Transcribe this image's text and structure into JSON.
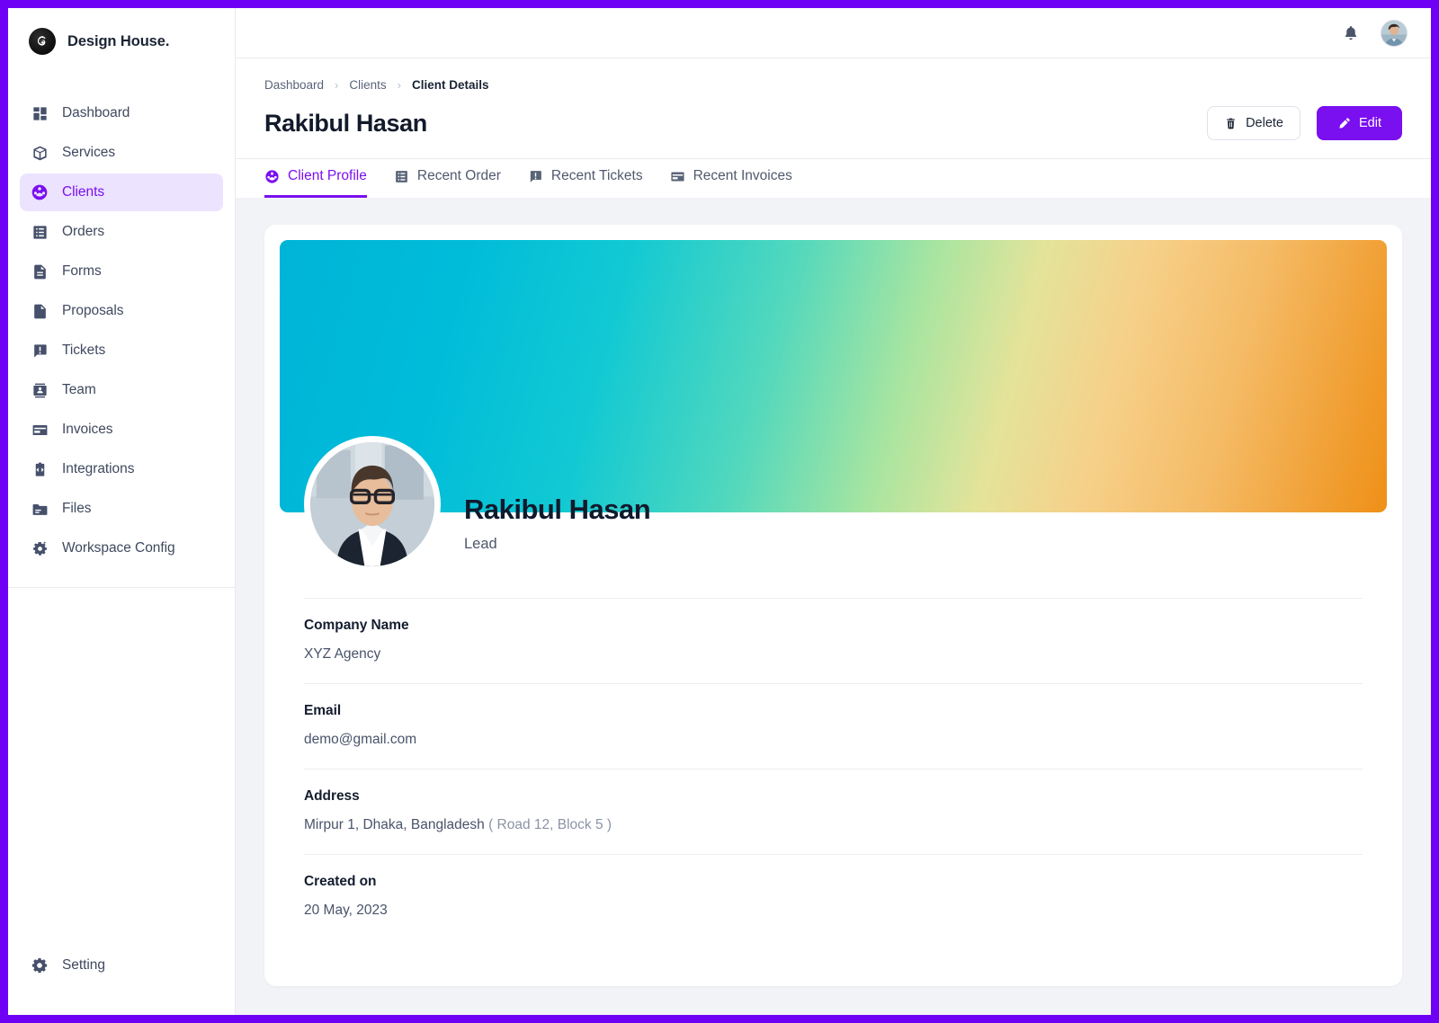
{
  "brand": {
    "name": "Design House.",
    "logo_icon": "swirl-logo-icon"
  },
  "sidebar": {
    "items": [
      {
        "label": "Dashboard",
        "icon": "dashboard-icon",
        "active": false
      },
      {
        "label": "Services",
        "icon": "box-icon",
        "active": false
      },
      {
        "label": "Clients",
        "icon": "clients-icon",
        "active": true
      },
      {
        "label": "Orders",
        "icon": "list-icon",
        "active": false
      },
      {
        "label": "Forms",
        "icon": "document-icon",
        "active": false
      },
      {
        "label": "Proposals",
        "icon": "proposal-icon",
        "active": false
      },
      {
        "label": "Tickets",
        "icon": "ticket-alert-icon",
        "active": false
      },
      {
        "label": "Team",
        "icon": "team-card-icon",
        "active": false
      },
      {
        "label": "Invoices",
        "icon": "invoice-card-icon",
        "active": false
      },
      {
        "label": "Integrations",
        "icon": "integrations-code-icon",
        "active": false
      },
      {
        "label": "Files",
        "icon": "folder-icon",
        "active": false
      },
      {
        "label": "Workspace Config",
        "icon": "gear-sparkle-icon",
        "active": false
      }
    ],
    "footer": {
      "label": "Setting",
      "icon": "gear-icon"
    }
  },
  "topbar": {
    "notification_icon": "bell-icon",
    "avatar_icon": "user-avatar"
  },
  "breadcrumb": {
    "items": [
      "Dashboard",
      "Clients",
      "Client Details"
    ],
    "separator": "›"
  },
  "header": {
    "title": "Rakibul Hasan",
    "delete_label": "Delete",
    "delete_icon": "trash-icon",
    "edit_label": "Edit",
    "edit_icon": "pencil-icon"
  },
  "tabs": [
    {
      "label": "Client Profile",
      "icon": "clients-icon",
      "active": true
    },
    {
      "label": "Recent Order",
      "icon": "list-icon",
      "active": false
    },
    {
      "label": "Recent Tickets",
      "icon": "ticket-alert-icon",
      "active": false
    },
    {
      "label": "Recent Invoices",
      "icon": "invoice-card-icon",
      "active": false
    }
  ],
  "profile": {
    "name": "Rakibul Hasan",
    "role": "Lead",
    "avatar_icon": "user-photo"
  },
  "fields": [
    {
      "label": "Company Name",
      "value": "XYZ Agency",
      "muted": ""
    },
    {
      "label": "Email",
      "value": "demo@gmail.com",
      "muted": ""
    },
    {
      "label": "Address",
      "value": "Mirpur 1, Dhaka, Bangladesh ",
      "muted": "( Road 12, Block 5 )"
    },
    {
      "label": "Created on",
      "value": "20 May, 2023",
      "muted": ""
    }
  ],
  "colors": {
    "accent_purple": "#7a0ff0",
    "accent_purple_soft": "#ece3fe",
    "page_bg": "#f2f3f7",
    "banner_start": "#00b4d8",
    "banner_mid": "#a9e5a0",
    "banner_end": "#ef9018",
    "text_dark": "#121a2b",
    "text_muted": "#49536a"
  }
}
